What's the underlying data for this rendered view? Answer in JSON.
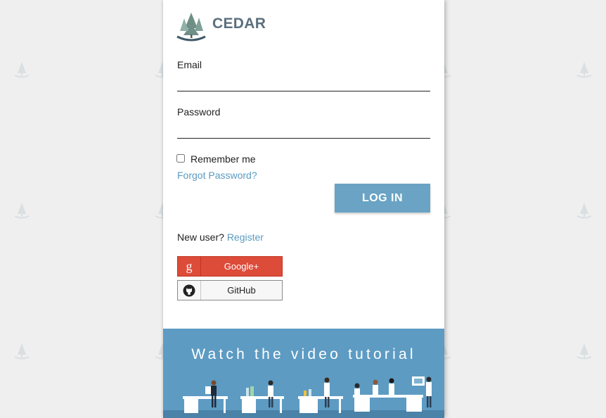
{
  "brand": {
    "name": "CEDAR"
  },
  "form": {
    "email_label": "Email",
    "email_value": "",
    "password_label": "Password",
    "password_value": "",
    "remember_label": "Remember me",
    "forgot_link": "Forgot Password?",
    "login_button": "LOG IN"
  },
  "signup": {
    "prompt": "New user?",
    "register_link": "Register"
  },
  "social": [
    {
      "label": "Google+",
      "icon": "google-plus-icon",
      "color": "#dd4b39"
    },
    {
      "label": "GitHub",
      "icon": "github-icon",
      "color": "#f7f7f7"
    }
  ],
  "video": {
    "title": "Watch the video tutorial",
    "background": "#5d9bc3"
  },
  "colors": {
    "page_bg": "#efefef",
    "accent": "#6aa3c4",
    "link": "#5a9bc0",
    "brand_text": "#5b6f7e"
  }
}
